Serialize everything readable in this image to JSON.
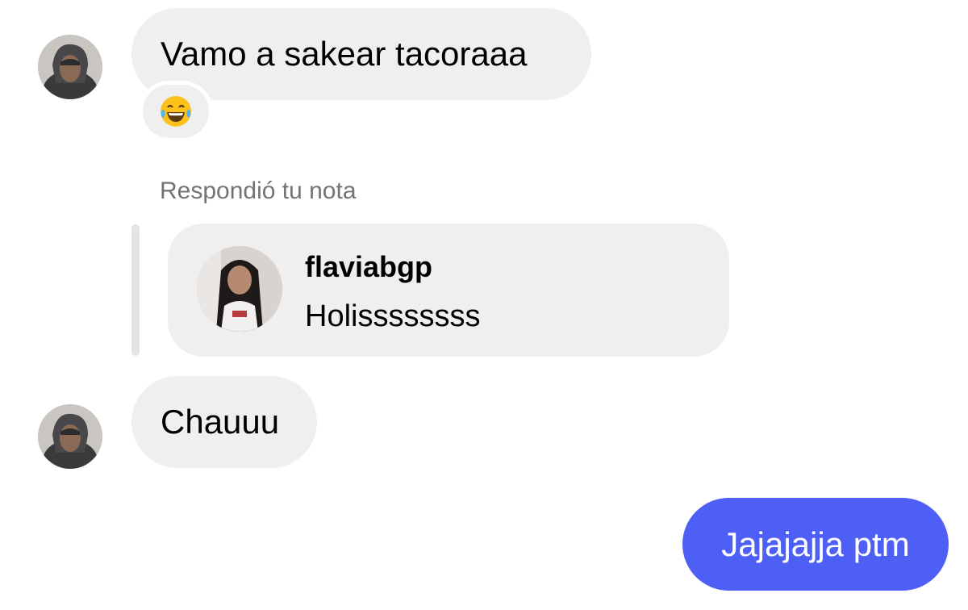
{
  "messages": {
    "incoming_1": {
      "text": "Vamo a sakear tacoraaa",
      "reaction_icon": "laughing-tears-emoji"
    },
    "reply": {
      "label": "Respondió tu nota",
      "note_username": "flaviabgp",
      "note_text": "Holissssssss"
    },
    "incoming_2": {
      "text": "Chauuu"
    },
    "outgoing_1": {
      "text": "Jajajajja ptm"
    }
  },
  "colors": {
    "incoming_bubble": "#efefef",
    "outgoing_bubble": "#4d5ff5",
    "secondary_text": "#737373"
  }
}
